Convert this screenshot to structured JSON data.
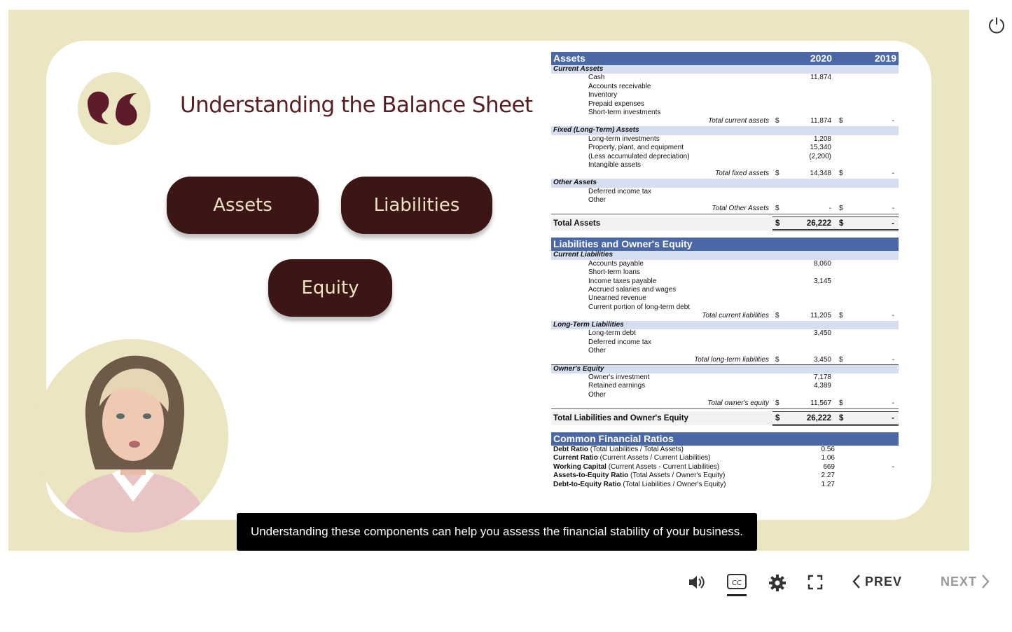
{
  "slide": {
    "title": "Understanding the Balance Sheet",
    "buttons": {
      "assets": "Assets",
      "liabilities": "Liabilities",
      "equity": "Equity"
    },
    "caption": "Understanding these components can help you assess the financial stability of your business."
  },
  "balance_sheet": {
    "year_current": "2020",
    "year_prior": "2019",
    "assets": {
      "header": "Assets",
      "current": {
        "label": "Current Assets",
        "items": [
          {
            "name": "Cash",
            "v2020": "11,874"
          },
          {
            "name": "Accounts receivable",
            "v2020": ""
          },
          {
            "name": "Inventory",
            "v2020": ""
          },
          {
            "name": "Prepaid expenses",
            "v2020": ""
          },
          {
            "name": "Short-term investments",
            "v2020": ""
          }
        ],
        "total_label": "Total current assets",
        "total_2020": "11,874",
        "total_2019": "-"
      },
      "fixed": {
        "label": "Fixed (Long-Term) Assets",
        "items": [
          {
            "name": "Long-term investments",
            "v2020": "1,208"
          },
          {
            "name": "Property, plant, and equipment",
            "v2020": "15,340"
          },
          {
            "name": "(Less accumulated depreciation)",
            "v2020": "(2,200)"
          },
          {
            "name": "Intangible assets",
            "v2020": ""
          }
        ],
        "total_label": "Total fixed assets",
        "total_2020": "14,348",
        "total_2019": "-"
      },
      "other": {
        "label": "Other Assets",
        "items": [
          {
            "name": "Deferred income tax",
            "v2020": ""
          },
          {
            "name": "Other",
            "v2020": ""
          }
        ],
        "total_label": "Total Other Assets",
        "total_2020": "-",
        "total_2019": "-"
      },
      "grand_total_label": "Total Assets",
      "grand_total_2020": "26,222",
      "grand_total_2019": "-"
    },
    "liabilities": {
      "header": "Liabilities and Owner's Equity",
      "current": {
        "label": "Current Liabilities",
        "items": [
          {
            "name": "Accounts payable",
            "v2020": "8,060"
          },
          {
            "name": "Short-term loans",
            "v2020": ""
          },
          {
            "name": "Income taxes payable",
            "v2020": "3,145"
          },
          {
            "name": "Accrued salaries and wages",
            "v2020": ""
          },
          {
            "name": "Unearned revenue",
            "v2020": ""
          },
          {
            "name": "Current portion of long-term debt",
            "v2020": ""
          }
        ],
        "total_label": "Total current liabilities",
        "total_2020": "11,205",
        "total_2019": "-"
      },
      "long_term": {
        "label": "Long-Term Liabilities",
        "items": [
          {
            "name": "Long-term debt",
            "v2020": "3,450"
          },
          {
            "name": "Deferred income tax",
            "v2020": ""
          },
          {
            "name": "Other",
            "v2020": ""
          }
        ],
        "total_label": "Total long-term liabilities",
        "total_2020": "3,450",
        "total_2019": "-"
      },
      "equity": {
        "label": "Owner's Equity",
        "items": [
          {
            "name": "Owner's investment",
            "v2020": "7,178"
          },
          {
            "name": "Retained earnings",
            "v2020": "4,389"
          },
          {
            "name": "Other",
            "v2020": ""
          }
        ],
        "total_label": "Total owner's equity",
        "total_2020": "11,567",
        "total_2019": "-"
      },
      "grand_total_label": "Total Liabilities and Owner's Equity",
      "grand_total_2020": "26,222",
      "grand_total_2019": "-"
    },
    "ratios": {
      "header": "Common Financial Ratios",
      "items": [
        {
          "name": "Debt Ratio",
          "desc": "(Total Liabilities / Total Assets)",
          "v2020": "0.56",
          "v2019": ""
        },
        {
          "name": "Current Ratio",
          "desc": "(Current Assets / Current Liabilities)",
          "v2020": "1.06",
          "v2019": ""
        },
        {
          "name": "Working Capital",
          "desc": "(Current Assets - Current Liabilities)",
          "v2020": "669",
          "v2019": "-"
        },
        {
          "name": "Assets-to-Equity Ratio",
          "desc": "(Total Assets / Owner's Equity)",
          "v2020": "2.27",
          "v2019": ""
        },
        {
          "name": "Debt-to-Equity Ratio",
          "desc": "(Total Liabilities / Owner's Equity)",
          "v2020": "1.27",
          "v2019": ""
        }
      ]
    },
    "currency": "$"
  },
  "player": {
    "prev_label": "PREV",
    "next_label": "NEXT",
    "icons": [
      "power-icon",
      "volume-icon",
      "closed-captions-icon",
      "settings-gear-icon",
      "fullscreen-icon",
      "chevron-left-icon",
      "chevron-right-icon"
    ],
    "colors": {
      "stage_bg": "#ebe5c1",
      "button_bg": "#3b1614",
      "title": "#5a1f22",
      "table_header": "#4a67a7",
      "table_section": "#d6dff0"
    }
  }
}
